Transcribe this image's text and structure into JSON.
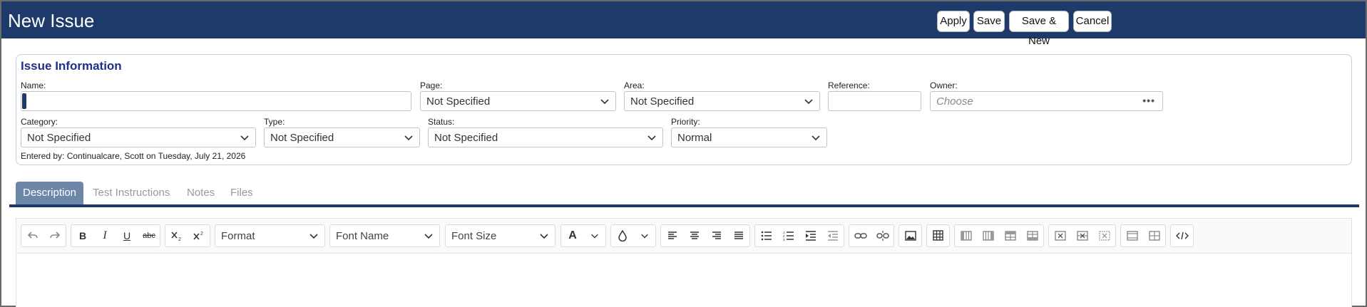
{
  "header": {
    "title": "New Issue",
    "buttons": {
      "apply": "Apply",
      "save": "Save",
      "save_new": "Save & New",
      "cancel": "Cancel"
    }
  },
  "colors": {
    "header_bg": "#1e3a6b",
    "panel_title": "#1e2f8a",
    "active_tab": "#6d87a8"
  },
  "issue_info": {
    "title": "Issue Information",
    "name": {
      "label": "Name:",
      "value": ""
    },
    "page": {
      "label": "Page:",
      "value": "Not Specified"
    },
    "area": {
      "label": "Area:",
      "value": "Not Specified"
    },
    "reference": {
      "label": "Reference:",
      "value": ""
    },
    "owner": {
      "label": "Owner:",
      "placeholder": "Choose",
      "more": "•••"
    },
    "category": {
      "label": "Category:",
      "value": "Not Specified"
    },
    "type": {
      "label": "Type:",
      "value": "Not Specified"
    },
    "status": {
      "label": "Status:",
      "value": "Not Specified"
    },
    "priority": {
      "label": "Priority:",
      "value": "Normal"
    },
    "entered_by": "Entered by: Continualcare, Scott on Tuesday, July 21, 2026"
  },
  "tabs": [
    {
      "label": "Description",
      "active": true
    },
    {
      "label": "Test Instructions",
      "active": false
    },
    {
      "label": "Notes",
      "active": false
    },
    {
      "label": "Files",
      "active": false
    }
  ],
  "editor": {
    "format": "Format",
    "font_name": "Font Name",
    "font_size": "Font Size",
    "bold": "B",
    "italic": "I",
    "underline": "U",
    "strike": "abc",
    "font_color": "A",
    "content": ""
  }
}
